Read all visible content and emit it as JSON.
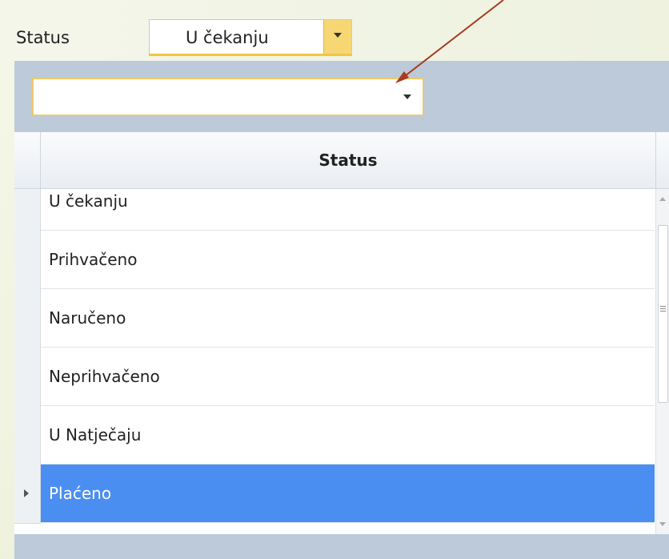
{
  "filter": {
    "label": "Status",
    "selected_value": "U čekanju"
  },
  "dropdown": {
    "search_value": "",
    "column_header": "Status",
    "options": [
      {
        "label": "U čekanju",
        "selected": false
      },
      {
        "label": "Prihvačeno",
        "selected": false
      },
      {
        "label": "Naručeno",
        "selected": false
      },
      {
        "label": "Neprihvačeno",
        "selected": false
      },
      {
        "label": "U Natječaju",
        "selected": false
      },
      {
        "label": "Plaćeno",
        "selected": true
      }
    ]
  },
  "colors": {
    "selection": "#4b8ef1",
    "accent_border": "#f2c542",
    "panel_background": "#bccad9",
    "annotation_arrow": "#a83a1e"
  },
  "icons": {
    "dropdown_arrow": "chevron-down-icon",
    "row_pointer": "row-pointer-icon",
    "annotation": "annotation-arrow-icon"
  }
}
